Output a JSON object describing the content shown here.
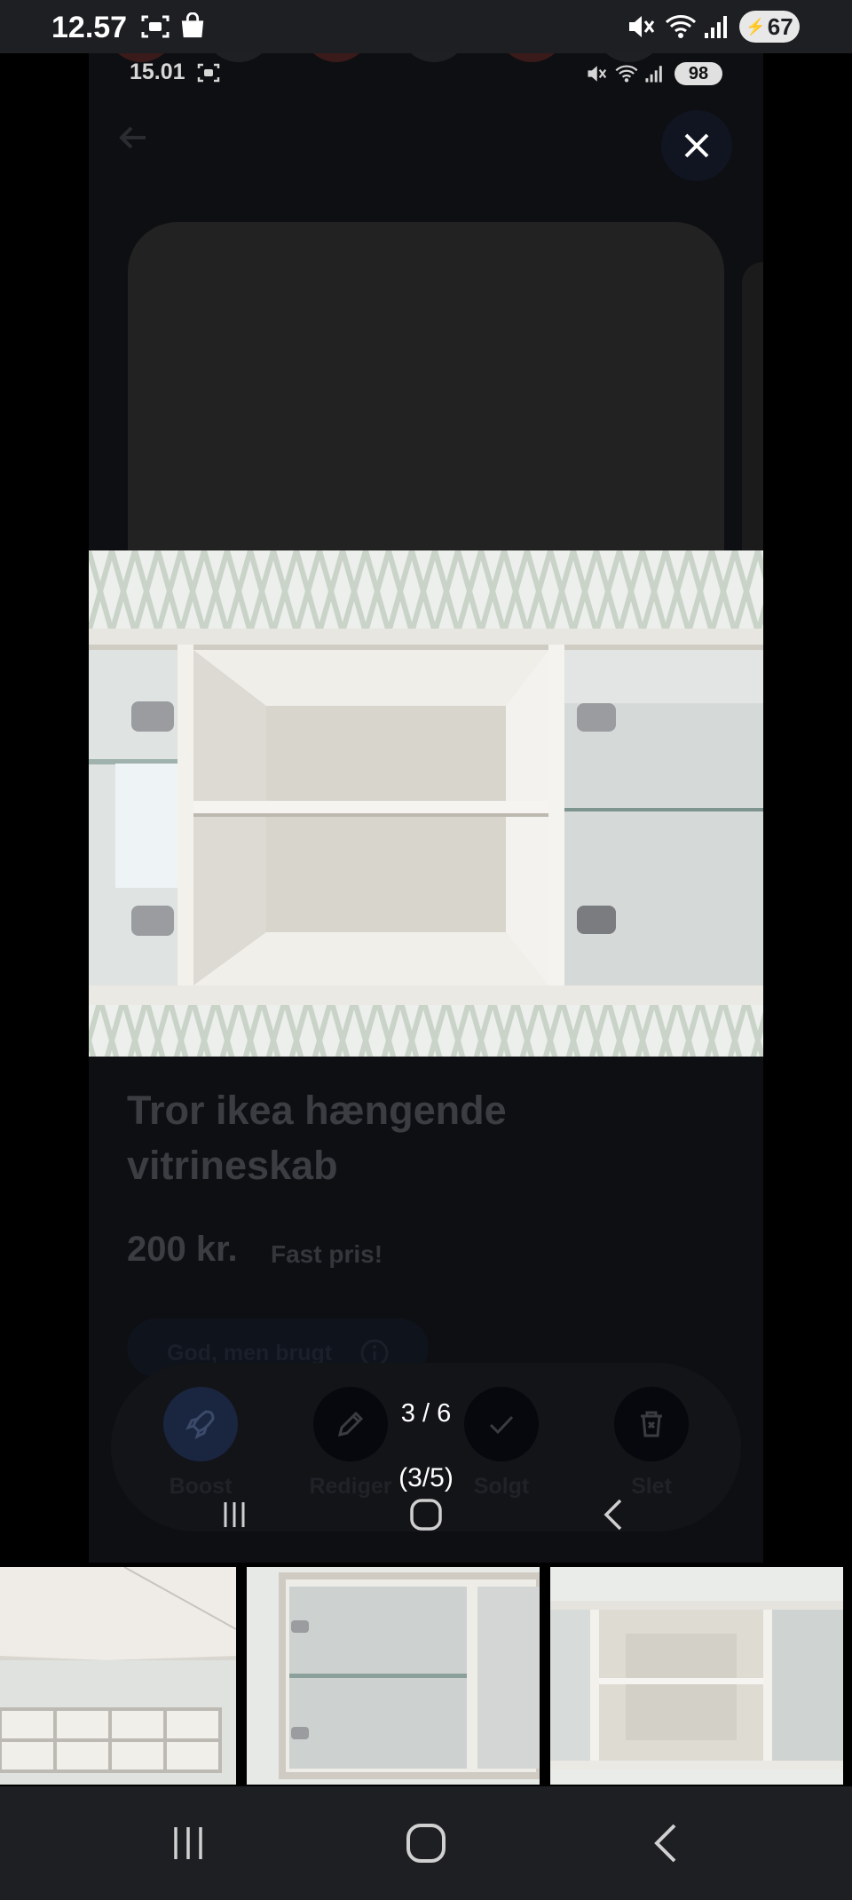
{
  "status_bar": {
    "time": "12.57",
    "battery": "67"
  },
  "underlying_screen": {
    "status_bar": {
      "time": "15.01",
      "battery": "98"
    },
    "listing": {
      "title": "Tror ikea hængende vitrineskab",
      "price": "200 kr.",
      "price_note": "Fast pris!",
      "condition": "God, men brugt"
    },
    "actions": [
      {
        "label": "Boost",
        "icon": "rocket-icon"
      },
      {
        "label": "Rediger",
        "icon": "pencil-icon"
      },
      {
        "label": "Solgt",
        "icon": "check-icon"
      },
      {
        "label": "Slet",
        "icon": "trash-icon"
      }
    ],
    "image_counter": "(3/5)"
  },
  "viewer": {
    "counter": "3 / 6",
    "close_icon": "close-icon"
  },
  "thumbnails": [
    {
      "label": "wall-cabinet-overview"
    },
    {
      "label": "glass-door-section"
    },
    {
      "label": "open-shelf-section"
    }
  ],
  "nav": {
    "recents": "recents-icon",
    "home": "home-icon",
    "back": "back-icon"
  }
}
